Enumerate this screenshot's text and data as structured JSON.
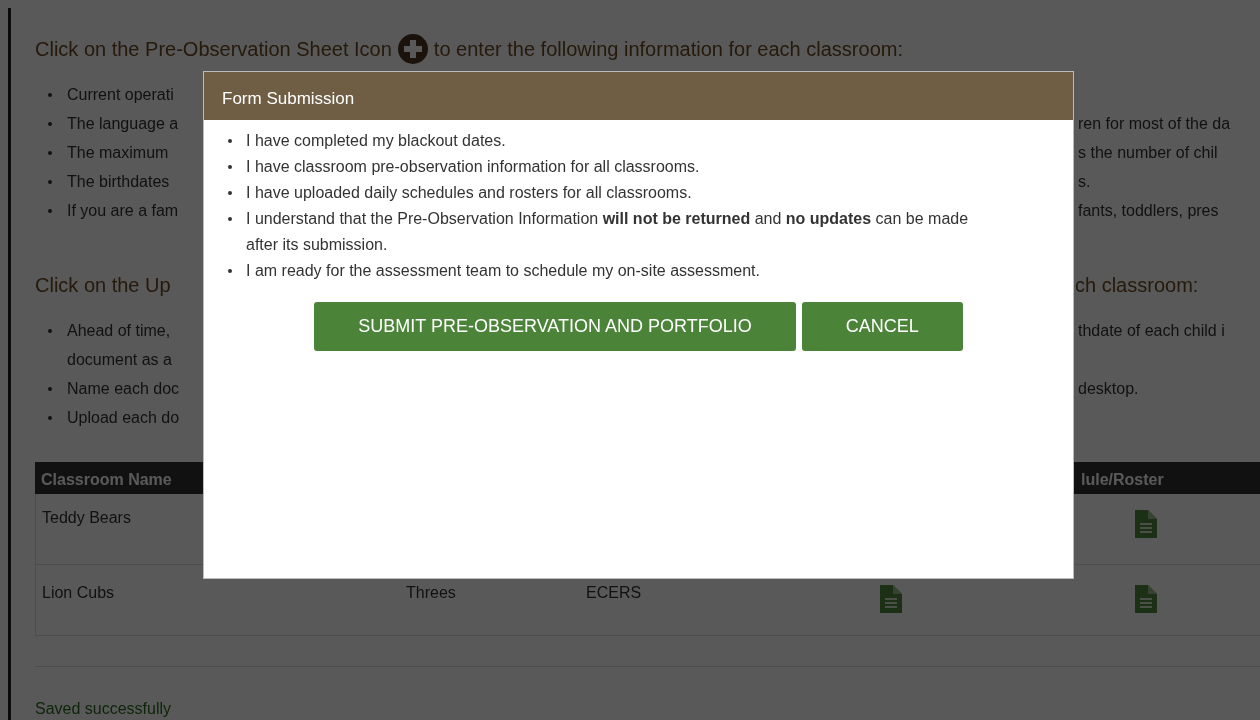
{
  "page": {
    "section_1": {
      "heading_before_icon": "Click on the Pre-Observation Sheet Icon",
      "heading_after_icon": "to enter the following information for each classroom:",
      "bullets": [
        {
          "left": "Current operati"
        },
        {
          "left": "The language a",
          "right": "ren for most of the da"
        },
        {
          "left": "The maximum",
          "right": "s the number of chil"
        },
        {
          "left": "The birthdates",
          "right": "s."
        },
        {
          "left": "If you are a fam",
          "right": "fants, toddlers, pres"
        }
      ]
    },
    "section_2": {
      "heading_left": "Click on the Up",
      "heading_right": "ch classroom:",
      "bullets": [
        {
          "left": "Ahead of time,",
          "right": "thdate of each child i",
          "continuation": "document as a"
        },
        {
          "left": "Name each doc",
          "right": "desktop."
        },
        {
          "left": "Upload each do"
        }
      ]
    },
    "table": {
      "header": {
        "column_1": "Classroom Name",
        "column_5": "lule/Roster"
      },
      "rows": [
        {
          "cells": [
            {
              "kind": "text",
              "text": "Teddy Bears"
            },
            {
              "kind": "blank"
            },
            {
              "kind": "blank"
            },
            {
              "kind": "blank"
            },
            {
              "kind": "document"
            }
          ]
        },
        {
          "cells": [
            {
              "kind": "text",
              "text": "Lion Cubs"
            },
            {
              "kind": "text",
              "text": "Threes"
            },
            {
              "kind": "text",
              "text": "ECERS"
            },
            {
              "kind": "document"
            },
            {
              "kind": "document"
            }
          ]
        }
      ]
    },
    "status": "Saved successfully"
  },
  "modal": {
    "title": "Form Submission",
    "items": [
      "I have completed my blackout dates.",
      "I have classroom pre-observation information for all classrooms.",
      "I have uploaded daily schedules and rosters for all classrooms.",
      "I understand that the Pre-Observation Information **will not be returned** and **no updates** can be made after its submission.",
      "I am ready for the assessment team to schedule my on-site assessment."
    ],
    "buttons": [
      "SUBMIT PRE-OBSERVATION AND PORTFOLIO",
      "CANCEL"
    ]
  }
}
